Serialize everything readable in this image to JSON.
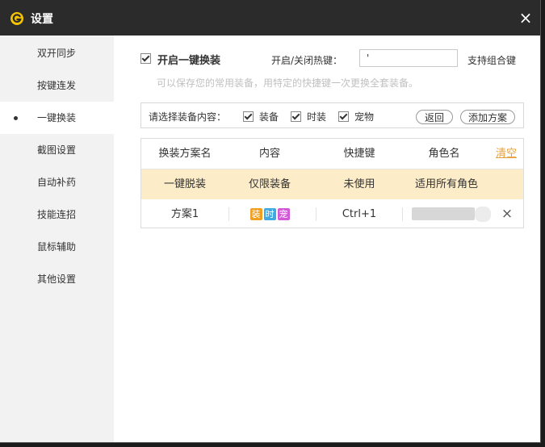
{
  "window": {
    "title": "设置",
    "close_glyph": "×"
  },
  "sidebar": {
    "items": [
      {
        "label": "双开同步",
        "active": false
      },
      {
        "label": "按键连发",
        "active": false
      },
      {
        "label": "一键换装",
        "active": true
      },
      {
        "label": "截图设置",
        "active": false
      },
      {
        "label": "自动补药",
        "active": false
      },
      {
        "label": "技能连招",
        "active": false
      },
      {
        "label": "鼠标辅助",
        "active": false
      },
      {
        "label": "其他设置",
        "active": false
      }
    ]
  },
  "main": {
    "enable": {
      "label": "开启一键换装",
      "checked": true
    },
    "hotkey": {
      "label": "开启/关闭热键：",
      "value": "'",
      "support_text": "支持组合键"
    },
    "hint": "可以保存您的常用装备，用特定的快捷键一次更换全套装备。",
    "select": {
      "prompt": "请选择装备内容：",
      "options": [
        {
          "label": "装备",
          "checked": true
        },
        {
          "label": "时装",
          "checked": true
        },
        {
          "label": "宠物",
          "checked": true
        }
      ],
      "back_button": "返回",
      "add_button": "添加方案"
    },
    "table": {
      "headers": [
        "换装方案名",
        "内容",
        "快捷键",
        "角色名"
      ],
      "clear_label": "清空",
      "rows": [
        {
          "name": "一键脱装",
          "content": "仅限装备",
          "hotkey": "未使用",
          "role": "适用所有角色"
        },
        {
          "name": "方案1",
          "tags": [
            "装",
            "时",
            "宠"
          ],
          "hotkey": "Ctrl+1",
          "delete_glyph": "×"
        }
      ]
    }
  },
  "colors": {
    "titlebar": "#2b2b2b",
    "sidebar_bg": "#f2f2f2",
    "accent_orange": "#e6a23c",
    "highlight_row": "#fcecc8",
    "tag_equip": "#f0a020",
    "tag_fashion": "#3fa9e0",
    "tag_pet": "#d25ad8"
  },
  "icons": {
    "logo": "app-logo-icon",
    "close": "close-icon",
    "delete": "delete-icon"
  }
}
